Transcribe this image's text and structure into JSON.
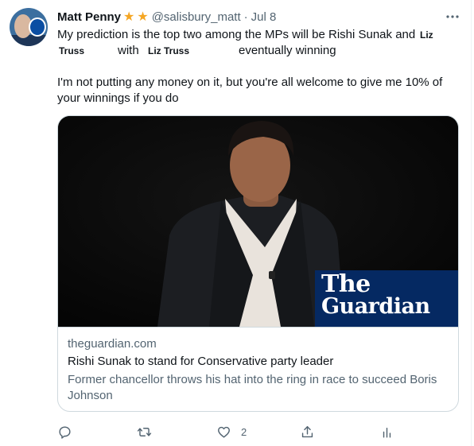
{
  "tweet": {
    "author_name": "Matt Penny",
    "handle": "@salisbury_matt",
    "separator": "·",
    "date": "Jul 8",
    "stars": [
      "★",
      "★"
    ],
    "more_glyph": "···",
    "line1_text": "My prediction is the top two among the MPs will be Rishi Sunak and",
    "name_tag_1a": "Liz",
    "name_tag_1b": "Truss",
    "with_text": "with",
    "name_tag_2": "Liz Truss",
    "line2_end": "eventually winning",
    "para2_line1": "I'm not putting any money on it, but you're all welcome to give me 10% of",
    "para2_line2": "your winnings if you do"
  },
  "card": {
    "domain": "theguardian.com",
    "title": "Rishi Sunak to stand for Conservative party leader",
    "description": "Former chancellor throws his hat into the ring in race to succeed Boris Johnson",
    "logo_line1": "The",
    "logo_line2": "Guardian",
    "logo_bg_color": "#052962",
    "image_description": "Man in dark suit against black background"
  },
  "actions": {
    "reply": {
      "icon": "reply-icon",
      "count": ""
    },
    "retweet": {
      "icon": "retweet-icon",
      "count": ""
    },
    "like": {
      "icon": "like-icon",
      "count": "2"
    },
    "share": {
      "icon": "share-icon",
      "count": ""
    },
    "analytics": {
      "icon": "analytics-icon",
      "count": ""
    }
  },
  "colors": {
    "text": "#0f1419",
    "secondary": "#536471",
    "border": "#cfd9de",
    "star": "#f5a623"
  }
}
